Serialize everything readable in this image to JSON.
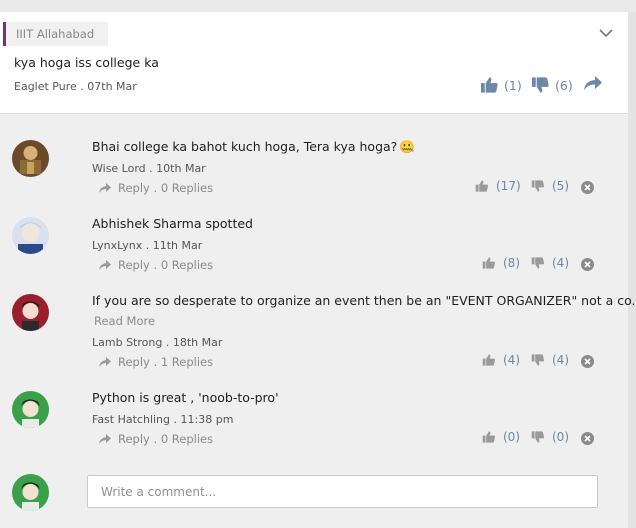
{
  "post": {
    "group": "IIIT Allahabad",
    "title": "kya hoga iss college ka",
    "author": "Eaglet Pure",
    "date": "07th Mar",
    "upvotes": "(1)",
    "downvotes": "(6)"
  },
  "comments": [
    {
      "text": "Bhai college ka bahot kuch hoga, Tera kya hoga?",
      "emoji": "🤐",
      "author": "Wise Lord",
      "date": "10th Mar",
      "reply": "Reply . 0 Replies",
      "up": "(17)",
      "down": "(5)",
      "read_more": ""
    },
    {
      "text": "Abhishek Sharma spotted",
      "emoji": "",
      "author": "LynxLynx",
      "date": "11th Mar",
      "reply": "Reply . 0 Replies",
      "up": "(8)",
      "down": "(4)",
      "read_more": ""
    },
    {
      "text": "If you are so desperate to organize an event then be an \"EVENT ORGANIZER\" not a co...",
      "emoji": "",
      "author": "Lamb Strong",
      "date": "18th Mar",
      "reply": "Reply . 1 Replies",
      "up": "(4)",
      "down": "(4)",
      "read_more": "Read More"
    },
    {
      "text": "Python is great , 'noob-to-pro'",
      "emoji": "",
      "author": "Fast Hatchling",
      "date": "11:38 pm",
      "reply": "Reply . 0 Replies",
      "up": "(0)",
      "down": "(0)",
      "read_more": ""
    }
  ],
  "composer": {
    "placeholder": "Write a comment..."
  },
  "colors": {
    "accent": "#6e86a8",
    "group_bar": "#6b3a6b",
    "icon_gray": "#9a9a9a"
  },
  "icons": [
    "chevron-down-icon",
    "thumbs-up-icon",
    "thumbs-down-icon",
    "share-icon",
    "reply-arrow-icon",
    "delete-icon"
  ]
}
